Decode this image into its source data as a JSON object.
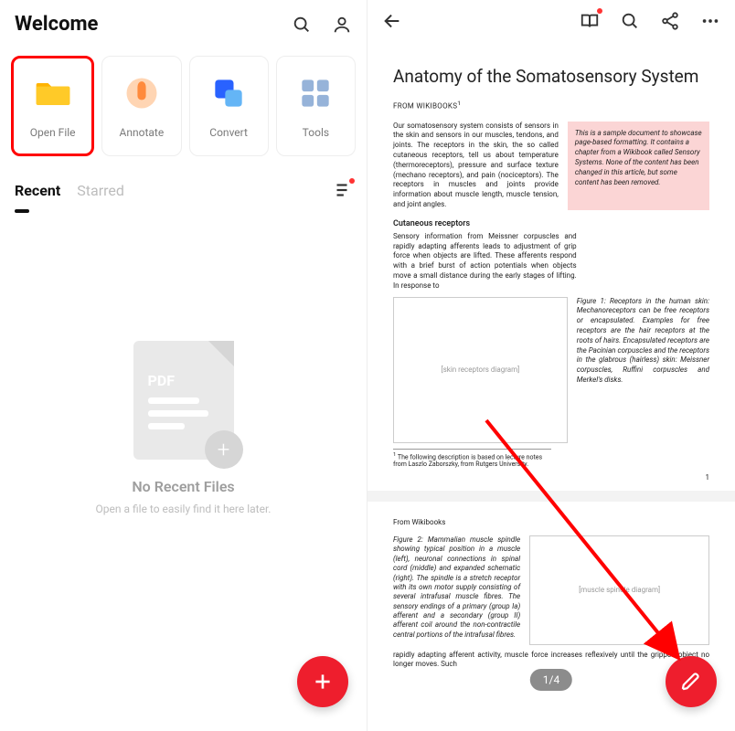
{
  "left": {
    "title": "Welcome",
    "tiles": [
      {
        "label": "Open File",
        "highlight": true
      },
      {
        "label": "Annotate"
      },
      {
        "label": "Convert"
      },
      {
        "label": "Tools"
      }
    ],
    "tabs": {
      "recent": "Recent",
      "starred": "Starred"
    },
    "empty": {
      "pdf": "PDF",
      "title": "No Recent Files",
      "sub": "Open a file to easily find it here later."
    }
  },
  "right": {
    "doc": {
      "title": "Anatomy of the Somatosensory System",
      "from": "FROM WIKIBOOKS",
      "from2": "From Wikibooks",
      "footnote_mark": "1",
      "body1": "Our somatosensory system consists of sensors in the skin and sensors in our muscles, tendons, and joints. The receptors in the skin, the so called cutaneous receptors, tell us about temperature (thermoreceptors), pressure and surface texture (mechano receptors), and pain (nociceptors). The receptors in muscles and joints provide information about muscle length, muscle tension, and joint angles.",
      "callout": "This is a sample document to showcase page-based formatting. It contains a chapter from a Wikibook called Sensory Systems. None of the content has been changed in this article, but some content has been removed.",
      "section": "Cutaneous receptors",
      "body2": "Sensory information from Meissner corpuscles and rapidly adapting afferents leads to adjustment of grip force when objects are lifted. These afferents respond with a brief burst of action potentials when objects move a small distance during the early stages of lifting. In response to",
      "fig1": "Figure 1: Receptors in the human skin: Mechanoreceptors can be free receptors or encapsulated. Examples for free receptors are the hair receptors at the roots of hairs. Encapsulated receptors are the Pacinian corpuscles and the receptors in the glabrous (hairless) skin: Meissner corpuscles, Ruffini corpuscles and Merkel's disks.",
      "fig1_ph": "[skin receptors diagram]",
      "foot": "The following description is based on lecture notes from Laszlo Zaborszky, from Rutgers University.",
      "pnum": "1",
      "fig2": "Figure 2: Mammalian muscle spindle showing typical position in a muscle (left), neuronal connections in spinal cord (middle) and expanded schematic (right). The spindle is a stretch receptor with its own motor supply consisting of several intrafusal muscle fibres. The sensory endings of a primary (group Ia) afferent and a secondary (group II) afferent coil around the non-contractile central portions of the intrafusal fibres.",
      "fig2_ph": "[muscle spindle diagram]",
      "after": "rapidly adapting afferent activity, muscle force increases reflexively until the gripped object no longer moves. Such"
    },
    "page_indicator": "1/4"
  }
}
